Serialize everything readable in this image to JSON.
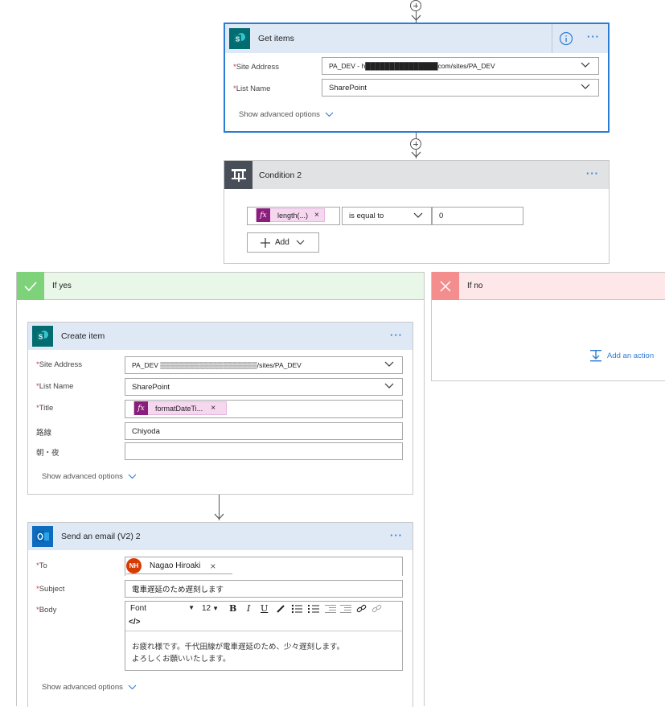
{
  "get_items": {
    "title": "Get items",
    "site_address_label": "Site Address",
    "site_address_value": "PA_DEV - h███████████████com/sites/PA_DEV",
    "list_name_label": "List Name",
    "list_name_value": "SharePoint",
    "show_advanced": "Show advanced options"
  },
  "condition": {
    "title": "Condition 2",
    "token_label": "length(...)",
    "operator": "is equal to",
    "value": "0",
    "add_label": "Add"
  },
  "if_yes": {
    "label": "If yes"
  },
  "if_no": {
    "label": "If no",
    "add_action": "Add an action"
  },
  "create_item": {
    "title": "Create item",
    "site_address_label": "Site Address",
    "site_address_value": "PA_DEV ▒▒▒▒▒▒▒▒▒▒▒▒▒▒▒▒▒▒▒▒/sites/PA_DEV",
    "list_name_label": "List Name",
    "list_name_value": "SharePoint",
    "title_label": "Title",
    "title_token": "formatDateTi...",
    "route_label": "路線",
    "route_value": "Chiyoda",
    "time_label": "朝・夜",
    "time_value": "",
    "show_advanced": "Show advanced options"
  },
  "send_email": {
    "title": "Send an email (V2) 2",
    "to_label": "To",
    "to_initials": "NH",
    "to_name": "Nagao Hiroaki",
    "subject_label": "Subject",
    "subject_value": "電車遅延のため遅刻します",
    "body_label": "Body",
    "font_label": "Font",
    "font_size": "12",
    "code_label": "</>",
    "body_line1": "お疲れ様です。千代田線が電車遅延のため、少々遅刻します。",
    "body_line2": "よろしくお願いいたします。",
    "show_advanced": "Show advanced options"
  },
  "colors": {
    "accent": "#2b7cd3",
    "sharepoint": "#036c70",
    "outlook": "#0f6cbd",
    "condition": "#484f58",
    "yes_bg": "#e9f7e8",
    "yes_icon": "#7ed27a",
    "no_bg": "#fde7e9",
    "no_icon": "#f48d8d",
    "token": "#f6d7f0",
    "fx": "#8a1e7c",
    "avatar": "#d83b01"
  }
}
